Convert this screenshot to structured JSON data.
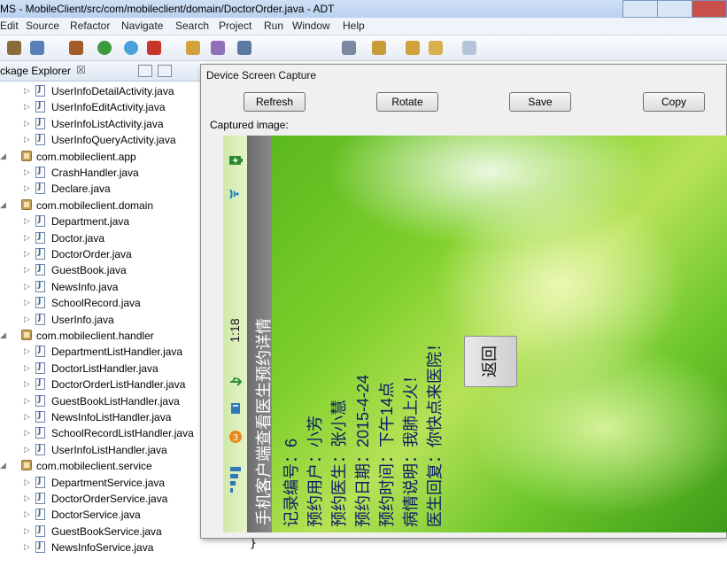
{
  "window": {
    "title": "MS - MobileClient/src/com/mobileclient/domain/DoctorOrder.java - ADT"
  },
  "menu": [
    "Edit",
    "Source",
    "Refactor",
    "Navigate",
    "Search",
    "Project",
    "Run",
    "Window",
    "Help"
  ],
  "explorer": {
    "title": "ckage Explorer",
    "close": "☒",
    "rows": [
      {
        "type": "file",
        "label": "UserInfoDetailActivity.java"
      },
      {
        "type": "file",
        "label": "UserInfoEditActivity.java"
      },
      {
        "type": "file",
        "label": "UserInfoListActivity.java"
      },
      {
        "type": "file",
        "label": "UserInfoQueryActivity.java"
      },
      {
        "type": "pkg",
        "label": "com.mobileclient.app"
      },
      {
        "type": "file",
        "label": "CrashHandler.java"
      },
      {
        "type": "file",
        "label": "Declare.java"
      },
      {
        "type": "pkg",
        "label": "com.mobileclient.domain"
      },
      {
        "type": "file",
        "label": "Department.java"
      },
      {
        "type": "file",
        "label": "Doctor.java"
      },
      {
        "type": "file",
        "label": "DoctorOrder.java"
      },
      {
        "type": "file",
        "label": "GuestBook.java"
      },
      {
        "type": "file",
        "label": "NewsInfo.java"
      },
      {
        "type": "file",
        "label": "SchoolRecord.java"
      },
      {
        "type": "file",
        "label": "UserInfo.java"
      },
      {
        "type": "pkg",
        "label": "com.mobileclient.handler"
      },
      {
        "type": "file",
        "label": "DepartmentListHandler.java"
      },
      {
        "type": "file",
        "label": "DoctorListHandler.java"
      },
      {
        "type": "file",
        "label": "DoctorOrderListHandler.java"
      },
      {
        "type": "file",
        "label": "GuestBookListHandler.java"
      },
      {
        "type": "file",
        "label": "NewsInfoListHandler.java"
      },
      {
        "type": "file",
        "label": "SchoolRecordListHandler.java"
      },
      {
        "type": "file",
        "label": "UserInfoListHandler.java"
      },
      {
        "type": "pkg",
        "label": "com.mobileclient.service"
      },
      {
        "type": "file",
        "label": "DepartmentService.java"
      },
      {
        "type": "file",
        "label": "DoctorOrderService.java"
      },
      {
        "type": "file",
        "label": "DoctorService.java"
      },
      {
        "type": "file",
        "label": "GuestBookService.java"
      },
      {
        "type": "file",
        "label": "NewsInfoService.java"
      }
    ]
  },
  "editor": {
    "visible_code": "}"
  },
  "dialog": {
    "title": "Device Screen Capture",
    "refresh": "Refresh",
    "rotate": "Rotate",
    "save": "Save",
    "copy": "Copy",
    "captured_label": "Captured image:"
  },
  "phone": {
    "time": "1:18",
    "header": "手机客户端查看医生预约详情",
    "lines": [
      "记录编号：6",
      "预约用户：小芳",
      "预约医生：张小慧",
      "预约日期：2015-4-24",
      "预约时间：下午14点",
      "病情说明：我肺上火！",
      "医生回复：你快点来医院！"
    ],
    "back_button": "返回",
    "notification_count": "3"
  },
  "colors": {
    "phone_text": "#0b1a66",
    "header_bg": "#7a7a7a",
    "phone_bg": "#6cc72a"
  }
}
